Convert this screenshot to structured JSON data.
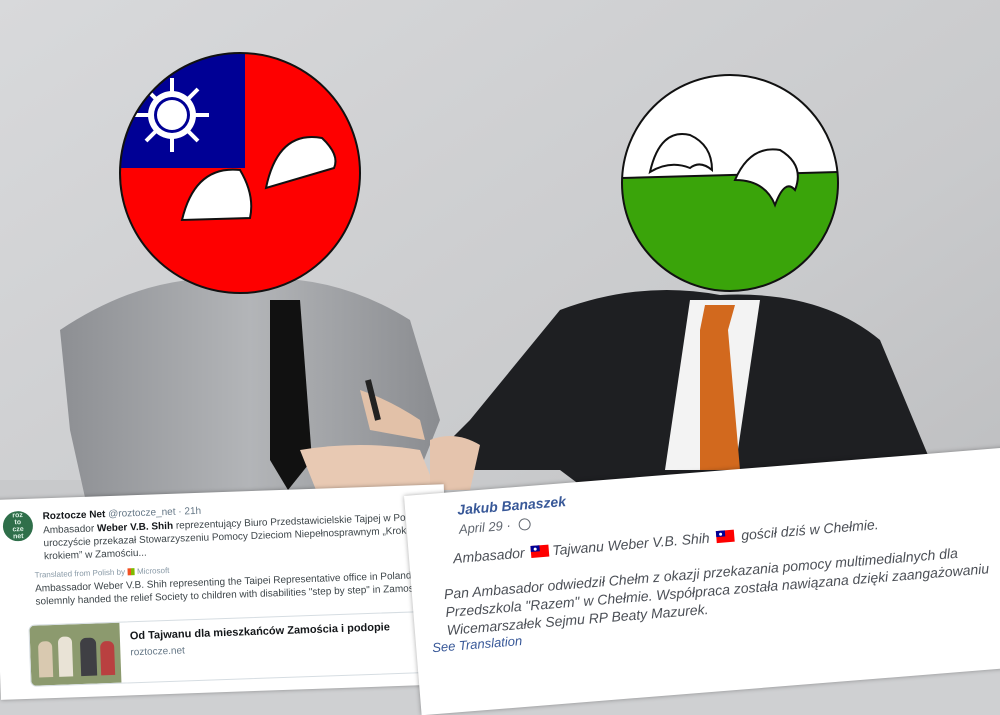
{
  "tweet": {
    "avatar_text": [
      "roz",
      "to",
      "cze",
      "net"
    ],
    "author_name": "Roztocze Net",
    "author_handle": "@roztocze_net",
    "time": "21h",
    "body_prefix": "Ambasador ",
    "body_bold": "Weber V.B. Shih",
    "body_rest": " reprezentujący Biuro Przedstawicielskie Tajpej w Polsce uroczyście przekazał Stowarzyszeniu Pomocy Dzieciom Niepełnosprawnym „Krok za krokiem” w Zamościu...",
    "translated_label": "Translated from Polish by",
    "translator": "Microsoft",
    "translation": "Ambassador Weber V.B. Shih representing the Taipei Representative office in Poland solemnly handed the relief Society to children with disabilities \"step by step\" in Zamosc...",
    "card_title": "Od Tajwanu dla mieszkańców Zamościa i podopie",
    "card_url": "roztocze.net"
  },
  "facebook": {
    "author_name": "Jakub Banaszek",
    "date": "April 29",
    "date_separator": " · ",
    "line1_a": "Ambasador ",
    "line1_b": "Tajwanu Weber V.B. Shih ",
    "line1_c": " gościł dziś w Chełmie.",
    "paragraph": "Pan Ambasador odwiedził Chełm z okazji przekazania pomocy multimedialnych dla Przedszkola \"Razem\" w Chełmie. Współpraca została nawiązana dzięki zaangażowaniu Wicemarszałek Sejmu RP Beaty Mazurek.",
    "see_translation": "See Translation"
  },
  "colors": {
    "taiwan_red": "#fe0000",
    "taiwan_blue": "#000095",
    "green_ball": "#3aa40a",
    "fb_link": "#385898"
  },
  "icons": [
    "taiwan-flag-icon",
    "globe-icon",
    "microsoft-logo-icon"
  ]
}
